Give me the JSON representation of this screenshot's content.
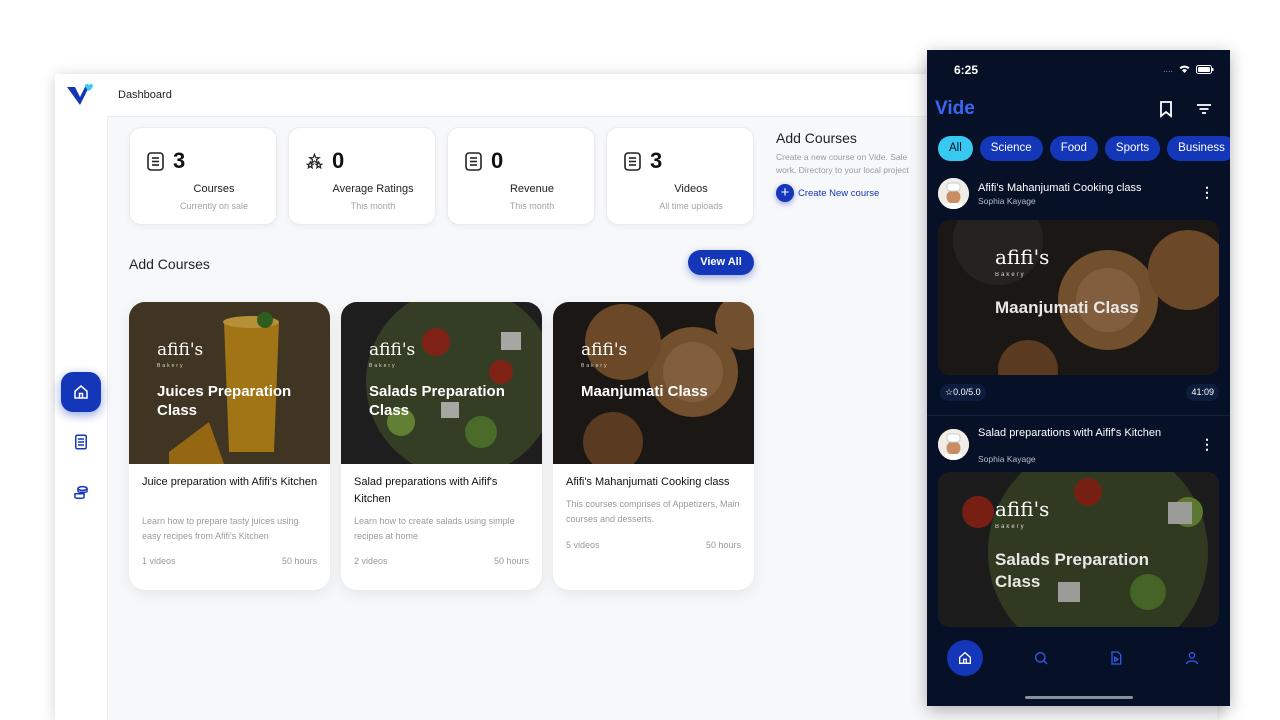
{
  "dashboard": {
    "breadcrumb": "Dashboard",
    "stats": [
      {
        "value": "3",
        "label": "Courses",
        "sub": "Currently on sale",
        "icon": "list-icon"
      },
      {
        "value": "0",
        "label": "Average Ratings",
        "sub": "This month",
        "icon": "stars-icon"
      },
      {
        "value": "0",
        "label": "Revenue",
        "sub": "This month",
        "icon": "list-icon"
      },
      {
        "value": "3",
        "label": "Videos",
        "sub": "All time uploads",
        "icon": "list-icon"
      }
    ],
    "side_panel": {
      "title": "Add Courses",
      "desc_line1": "Create a new course on Vide. Sale",
      "desc_line2": "work. Directory to your local project",
      "create_label": "Create New course"
    },
    "section_title": "Add Courses",
    "view_all": "View All",
    "brand_text": "afifi's",
    "brand_sub": "Bakery",
    "courses": [
      {
        "image_title": "Juices Preparation Class",
        "name": "Juice preparation with Afifi's Kitchen",
        "desc": "Learn how to prepare tasty juices using easy recipes from Afifi's Kitchen",
        "videos": "1 videos",
        "hours": "50 hours"
      },
      {
        "image_title": "Salads Preparation Class",
        "name": "Salad preparations with Aifif's Kitchen",
        "desc": "Learn how to create salads using simple recipes at home",
        "videos": "2 videos",
        "hours": "50 hours"
      },
      {
        "image_title": "Maanjumati Class",
        "name": "Afifi's Mahanjumati Cooking class",
        "desc": "This courses comprises of Appetizers, Main courses and desserts.",
        "videos": "5 videos",
        "hours": "50 hours"
      }
    ]
  },
  "phone": {
    "time": "6:25",
    "logo": "Vide",
    "chips": [
      "All",
      "Science",
      "Food",
      "Sports",
      "Business"
    ],
    "feed": [
      {
        "title": "Afifi's Mahanjumati Cooking class",
        "author": "Sophia Kayage",
        "image_title": "Maanjumati Class",
        "rating": "☆0.0/5.0",
        "duration": "41:09"
      },
      {
        "title": "Salad preparations with Aifif's Kitchen",
        "author": "Sophia Kayage",
        "image_title": "Salads Preparation Class"
      }
    ]
  },
  "colors": {
    "accent": "#1436b8",
    "chip_active": "#38c9f2",
    "phone_bg": "#061127"
  }
}
